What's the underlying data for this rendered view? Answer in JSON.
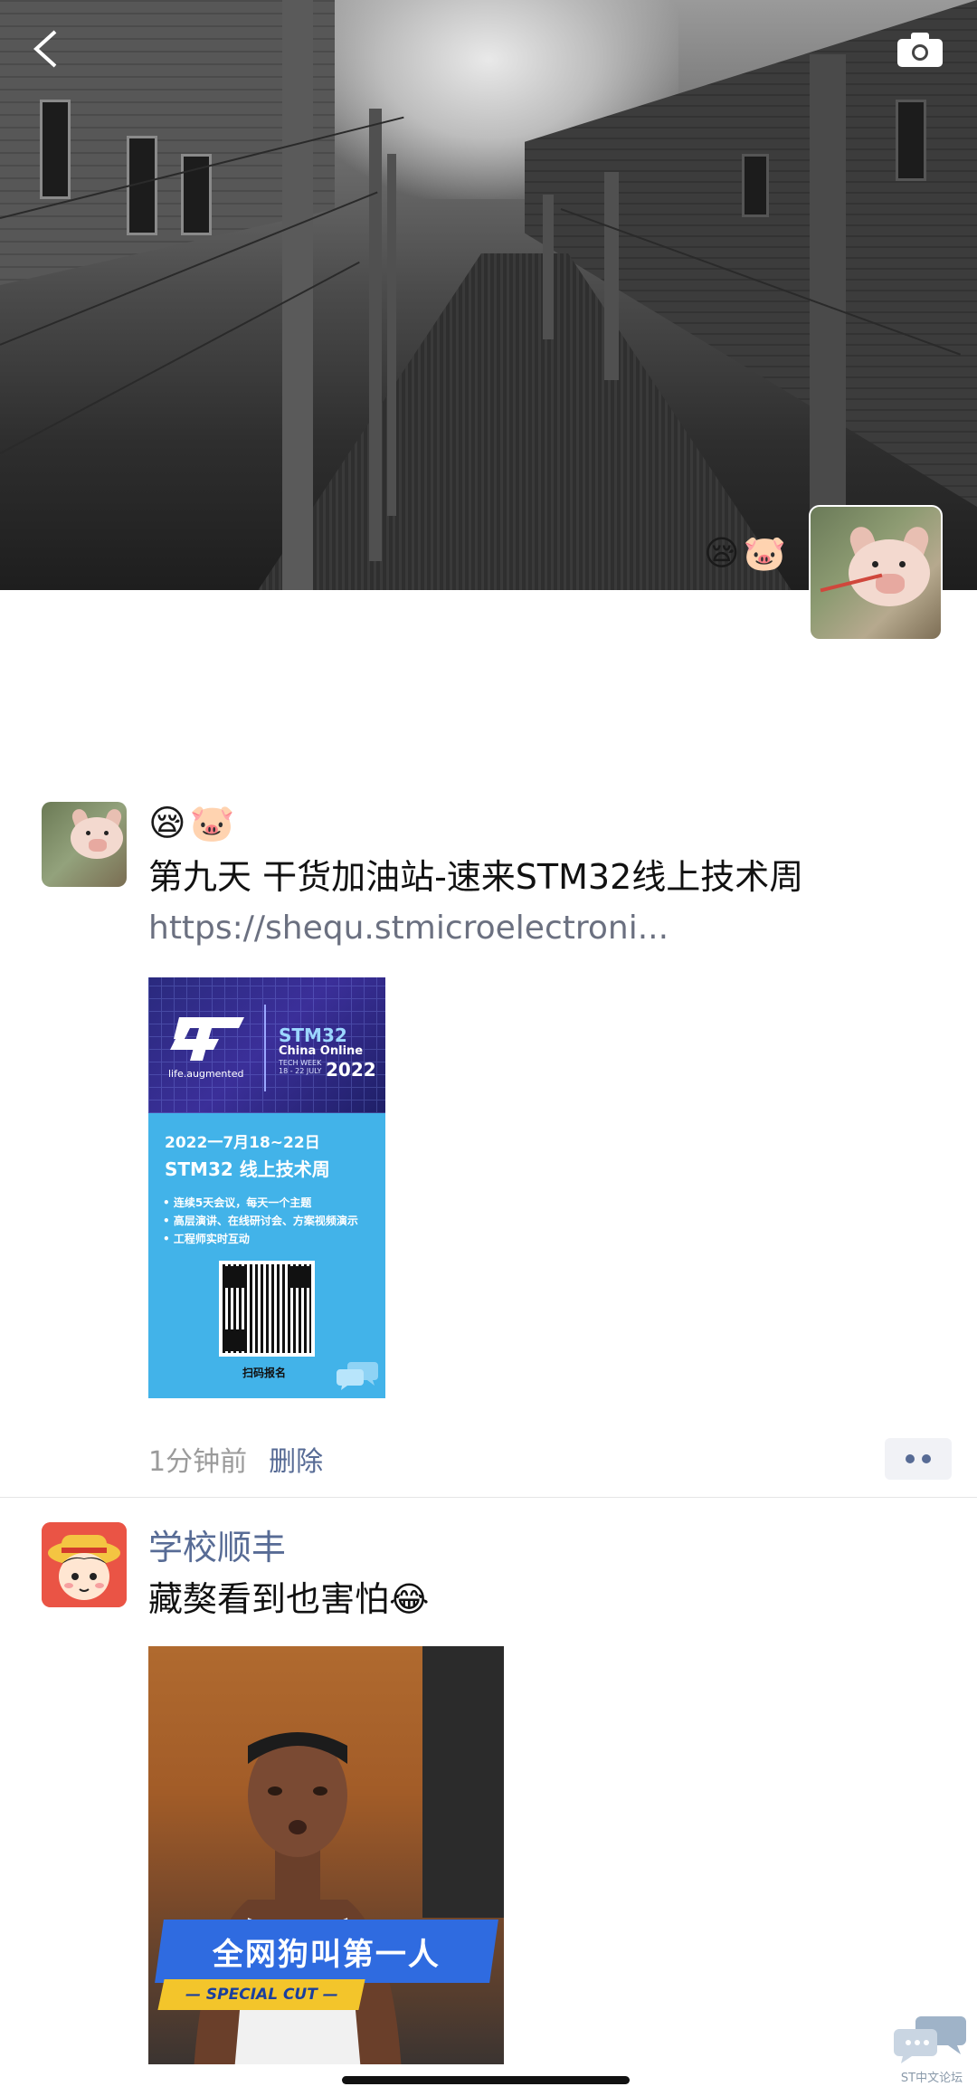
{
  "cover": {
    "cover_emoji": "😪🐷",
    "back_icon": "chevron-left-icon",
    "camera_icon": "camera-icon"
  },
  "posts": [
    {
      "emoji_name": "😪🐷",
      "text": "第九天  干货加油站-速来STM32线上技术周",
      "link": "https://shequ.stmicroelectroni...",
      "poster": {
        "brand_tag": "life.augmented",
        "event_title": "STM32",
        "event_sub": "China Online",
        "event_week": "TECH WEEK",
        "event_dates": "18 - 22 JULY",
        "event_year": "2022",
        "date_line": "2022一7月18~22日",
        "title": "STM32 线上技术周",
        "bullets": [
          "• 连续5天会议，每天一个主题",
          "• 高层演讲、在线研讨会、方案视频演示",
          "• 工程师实时互动"
        ],
        "scan_label": "扫码报名",
        "footer_mark": "ST中文论坛"
      },
      "time": "1分钟前",
      "delete_label": "删除"
    },
    {
      "nickname": "学校顺丰",
      "text": "藏獒看到也害怕😂",
      "video": {
        "banner": "全网狗叫第一人",
        "sub": "— SPECIAL CUT —"
      }
    }
  ],
  "watermark": "ST中文论坛",
  "colors": {
    "nickname": "#576b95",
    "meta": "#9b9b9b",
    "poster_blue": "#42b3e9"
  }
}
